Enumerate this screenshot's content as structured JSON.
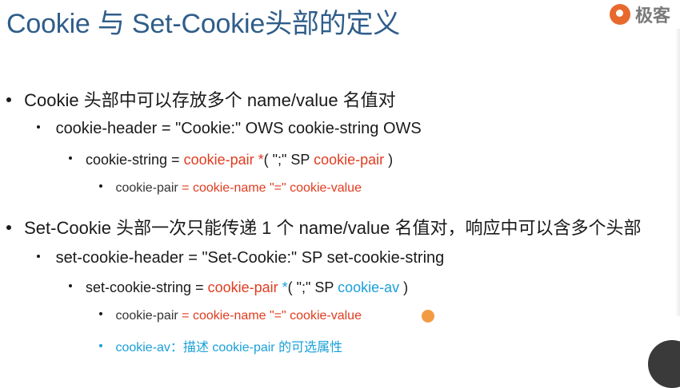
{
  "title": "Cookie 与 Set-Cookie头部的定义",
  "logo": {
    "text": "极客"
  },
  "items": {
    "a1": "Cookie 头部中可以存放多个 name/value 名值对",
    "a1_1": "cookie-header = \"Cookie:\" OWS cookie-string OWS",
    "a1_1_1": {
      "prefix": "cookie-string = ",
      "p1": "cookie-pair",
      "p2": " *",
      "p3": "( \";\" SP ",
      "p4": "cookie-pair",
      "p5": " )"
    },
    "a1_1_1_1": {
      "prefix": "cookie-pair ",
      "eq": "=",
      "rest": " cookie-name \"=\" cookie-value"
    },
    "b1": "Set-Cookie 头部一次只能传递 1 个 name/value 名值对，响应中可以含多个头部",
    "b1_1": "set-cookie-header = \"Set-Cookie:\" SP set-cookie-string",
    "b1_1_1": {
      "prefix": "set-cookie-string = ",
      "p1": "cookie-pair",
      "p2": " *",
      "p3": "( \";\" SP ",
      "p4": "cookie-av",
      "p5": " )"
    },
    "b1_1_1_1": {
      "prefix": "cookie-pair ",
      "eq": "=",
      "rest": " cookie-name \"=\" cookie-value"
    },
    "b1_1_1_2": "cookie-av：描述 cookie-pair 的可选属性"
  }
}
